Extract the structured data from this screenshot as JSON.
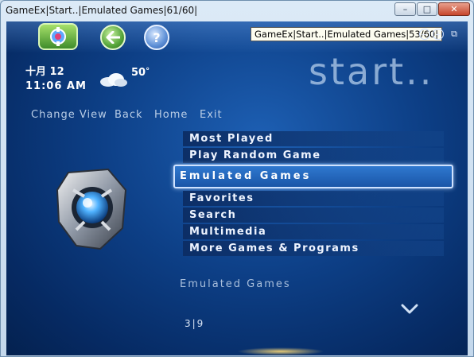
{
  "window": {
    "title": "GameEx|Start..|Emulated Games|61/60|",
    "minimize": "–",
    "maximize": "□",
    "close": "✕"
  },
  "topbar": {
    "help_glyph": "?",
    "tooltip": "GameEx|Start..|Emulated Games|53/60|",
    "plus_glyph": "+",
    "restore_glyph": "⧉",
    "minus_glyph": "−"
  },
  "info": {
    "date": "十月 12",
    "time": "11:06 AM",
    "temperature": "50",
    "degree": "°"
  },
  "brand": "start..",
  "nav": {
    "change_view": "Change View",
    "back": "Back",
    "home": "Home",
    "exit": "Exit"
  },
  "menu": {
    "items_above": [
      "Most Played",
      "Play Random Game"
    ],
    "selected": "Emulated Games",
    "items_below": [
      "Favorites",
      "Search",
      "Multimedia",
      "More Games & Programs"
    ]
  },
  "footer": {
    "caption": "Emulated Games",
    "pager": "3|9"
  },
  "icons": [
    "start-orb-icon",
    "back-arrow-icon",
    "help-icon",
    "cloud-icon",
    "chevron-down-icon",
    "emulated-games-art"
  ],
  "colors": {
    "background": "#0d3f86",
    "selected": "#1a56a8",
    "menu_text": "#eef4ff"
  }
}
